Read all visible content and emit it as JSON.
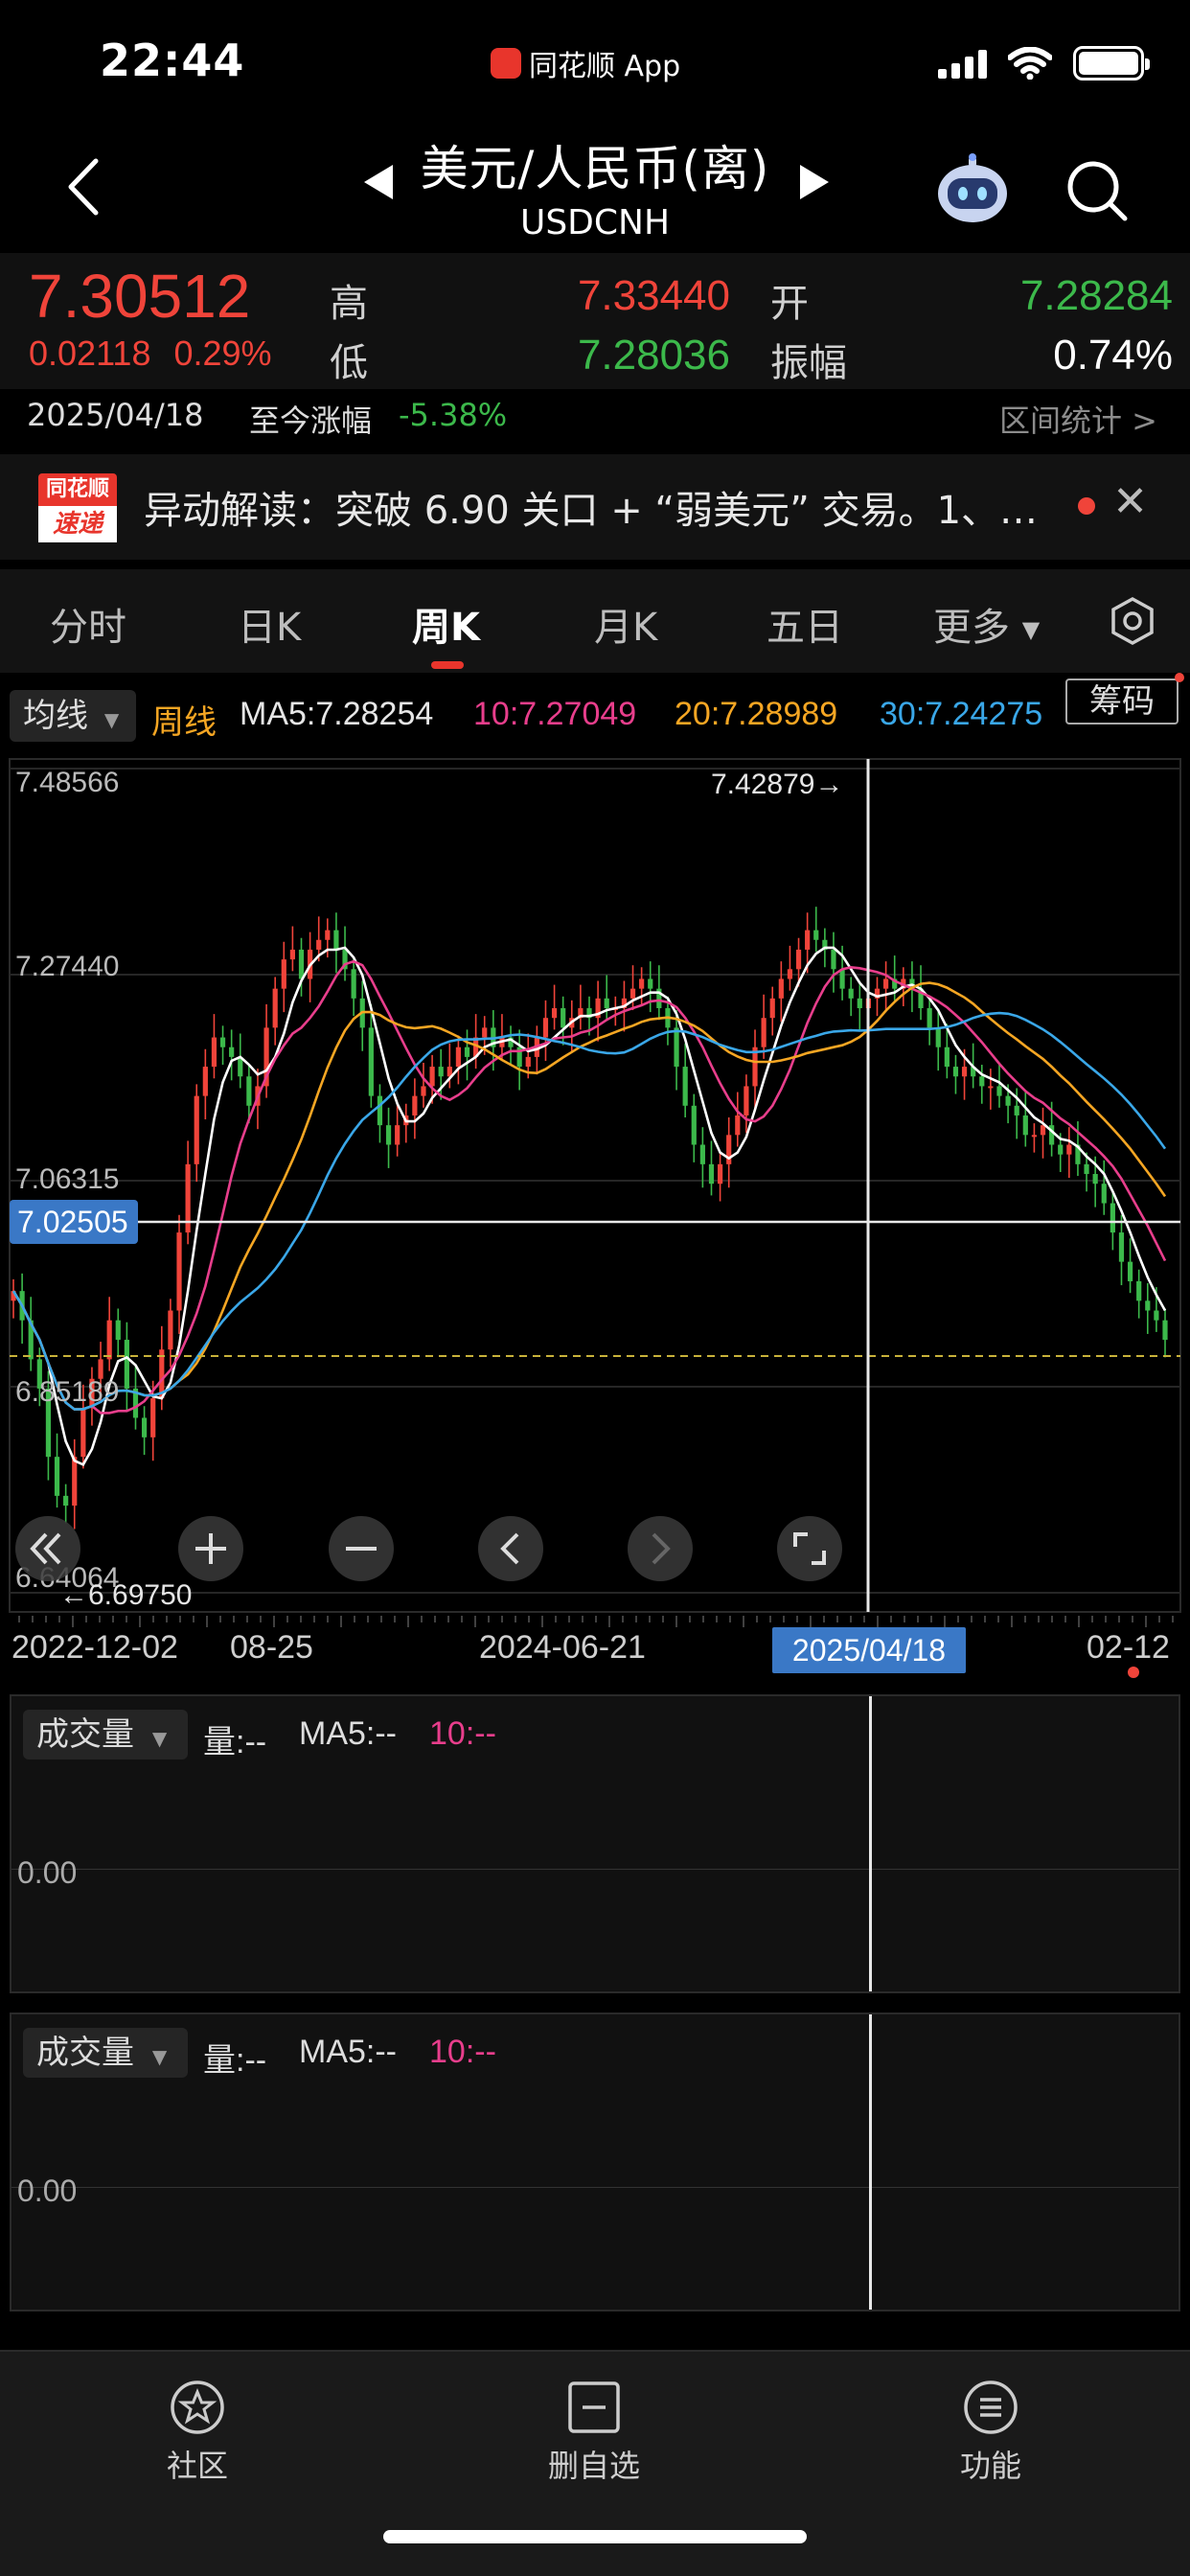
{
  "status_bar": {
    "time": "22:44",
    "back_app": "同花顺 App"
  },
  "nav": {
    "title": "美元/人民币(离)",
    "code": "USDCNH"
  },
  "quote": {
    "last": "7.30512",
    "change": "0.02118",
    "change_pct": "0.29%",
    "high_label": "高",
    "high": "7.33440",
    "low_label": "低",
    "low": "7.28036",
    "open_label": "开",
    "open": "7.28284",
    "amp_label": "振幅",
    "amp": "0.74%"
  },
  "range": {
    "date": "2025/04/18",
    "label": "至今涨幅",
    "value": "-5.38%",
    "stat": "区间统计 >"
  },
  "news": {
    "logo_top": "同花顺",
    "logo_bottom": "速递",
    "text": "异动解读：突破 6.90 关口 + “弱美元” 交易。1、…",
    "close": "✕"
  },
  "tabs": [
    {
      "label": "分时"
    },
    {
      "label": "日K"
    },
    {
      "label": "周K"
    },
    {
      "label": "月K"
    },
    {
      "label": "五日"
    },
    {
      "label": "更多"
    }
  ],
  "ma_row": {
    "select": "均线",
    "period": "周线",
    "ma5": "MA5:7.28254",
    "ma10": "10:7.27049",
    "ma20": "20:7.28989",
    "ma30": "30:7.24275",
    "chip": "筹码"
  },
  "kline_labels": {
    "y_top": "7.48566",
    "y_2": "7.27440",
    "y_3": "7.06315",
    "y_4": "6.85189",
    "y_bottom": "6.64064",
    "crosshair_price": "7.02505",
    "max_mark": "7.42879→",
    "min_mark": "←6.69750"
  },
  "x_axis": {
    "l1": "2022-12-02",
    "l2": "08-25",
    "l3": "2024-06-21",
    "selected": "2025/04/18",
    "l5": "02-12"
  },
  "vol_panels": [
    {
      "select": "成交量",
      "vol": "量:--",
      "ma5": "MA5:--",
      "ma10": "10:--",
      "zero": "0.00"
    },
    {
      "select": "成交量",
      "vol": "量:--",
      "ma5": "MA5:--",
      "ma10": "10:--",
      "zero": "0.00"
    }
  ],
  "bottom_nav": [
    {
      "label": "社区"
    },
    {
      "label": "删自选"
    },
    {
      "label": "功能"
    }
  ],
  "colors": {
    "up": "#f0443a",
    "down": "#3cb94b",
    "ma5": "#ffffff",
    "ma10": "#e83e8c",
    "ma20": "#f5a623",
    "ma30": "#3aa7e8",
    "accent": "#3a78c6"
  },
  "chart_data": {
    "type": "candlestick",
    "title": "",
    "xlabel": "",
    "ylabel": "",
    "x_ticks": [
      "2022-12-02",
      "08-25",
      "2024-06-21",
      "2025/04/18",
      "02-12"
    ],
    "y_ticks": [
      7.48566,
      7.2744,
      7.06315,
      6.85189,
      6.64064
    ],
    "ylim": [
      6.64064,
      7.48566
    ],
    "close": [
      6.95,
      6.92,
      6.88,
      6.85,
      6.78,
      6.74,
      6.73,
      6.78,
      6.83,
      6.86,
      6.88,
      6.92,
      6.9,
      6.85,
      6.82,
      6.8,
      6.84,
      6.89,
      6.93,
      7.01,
      7.08,
      7.15,
      7.18,
      7.21,
      7.2,
      7.19,
      7.17,
      7.14,
      7.16,
      7.22,
      7.26,
      7.29,
      7.3,
      7.27,
      7.3,
      7.31,
      7.32,
      7.3,
      7.28,
      7.25,
      7.22,
      7.15,
      7.12,
      7.1,
      7.12,
      7.13,
      7.15,
      7.16,
      7.18,
      7.17,
      7.18,
      7.2,
      7.19,
      7.21,
      7.22,
      7.2,
      7.21,
      7.2,
      7.18,
      7.19,
      7.21,
      7.23,
      7.24,
      7.22,
      7.23,
      7.24,
      7.23,
      7.25,
      7.24,
      7.24,
      7.25,
      7.26,
      7.27,
      7.26,
      7.24,
      7.22,
      7.18,
      7.14,
      7.1,
      7.08,
      7.06,
      7.08,
      7.11,
      7.13,
      7.16,
      7.2,
      7.23,
      7.25,
      7.27,
      7.28,
      7.3,
      7.32,
      7.31,
      7.3,
      7.28,
      7.26,
      7.25,
      7.24,
      7.25,
      7.26,
      7.27,
      7.26,
      7.27,
      7.26,
      7.24,
      7.22,
      7.2,
      7.18,
      7.17,
      7.18,
      7.17,
      7.16,
      7.16,
      7.15,
      7.14,
      7.13,
      7.11,
      7.11,
      7.12,
      7.1,
      7.09,
      7.1,
      7.08,
      7.07,
      7.06,
      7.04,
      7.01,
      6.98,
      6.96,
      6.94,
      6.93,
      6.92,
      6.9
    ],
    "series": [
      {
        "name": "MA5",
        "color": "#ffffff"
      },
      {
        "name": "10",
        "color": "#e83e8c"
      },
      {
        "name": "20",
        "color": "#f5a623"
      },
      {
        "name": "30",
        "color": "#3aa7e8"
      }
    ],
    "crosshair": {
      "x": "2025/04/18",
      "y": 7.02505
    },
    "max": 7.42879,
    "min": 6.6975
  }
}
